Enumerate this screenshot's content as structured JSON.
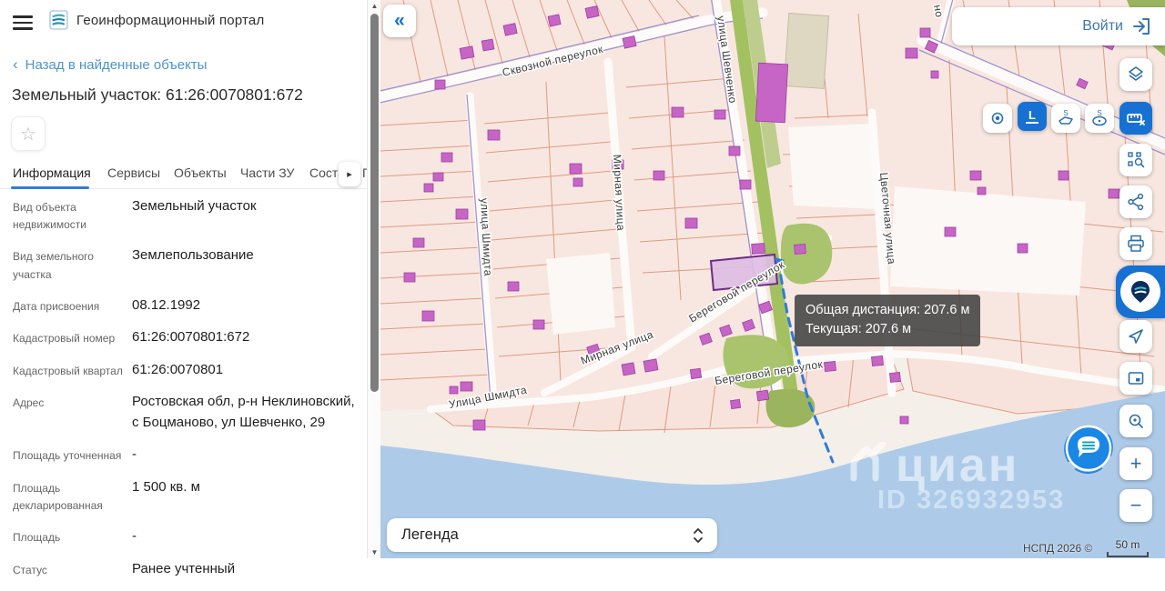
{
  "header": {
    "app_title": "Геоинформационный портал"
  },
  "panel": {
    "back_chevron": "‹",
    "back_link": "Назад в найденные объекты",
    "title": "Земельный участок: 61:26:0070801:672",
    "star": "☆",
    "tabs": [
      {
        "label": "Информация"
      },
      {
        "label": "Сервисы"
      },
      {
        "label": "Объекты"
      },
      {
        "label": "Части ЗУ"
      },
      {
        "label": "Соста"
      },
      {
        "label": "Г"
      }
    ],
    "tabs_arrow": "▸",
    "scroll_up": "▲",
    "scroll_down": "▼",
    "fields": [
      {
        "label": "Вид объекта недвижимости",
        "value": "Земельный участок"
      },
      {
        "label": "Вид земельного участка",
        "value": "Землепользование"
      },
      {
        "label": "Дата присвоения",
        "value": "08.12.1992"
      },
      {
        "label": "Кадастровый номер",
        "value": "61:26:0070801:672"
      },
      {
        "label": "Кадастровый квартал",
        "value": "61:26:0070801"
      },
      {
        "label": "Адрес",
        "value": "Ростовская обл, р-н Неклиновский, с Боцманово, ул Шевченко, 29"
      },
      {
        "label": "Площадь уточненная",
        "value": "-"
      },
      {
        "label": "Площадь декларированная",
        "value": "1 500 кв. м"
      },
      {
        "label": "Площадь",
        "value": "-"
      },
      {
        "label": "Статус",
        "value": "Ранее учтенный"
      }
    ]
  },
  "map": {
    "collapse_glyph": "«",
    "login_label": "Войти",
    "measure_length_glyph": "L",
    "measure_area_glyph": "S",
    "zoom_in": "+",
    "zoom_out": "−",
    "tooltip_line1": "Общая дистанция: 207.6 м",
    "tooltip_line2": "Текущая: 207.6 м",
    "legend_label": "Легенда",
    "attribution": "НСПД 2026 ©",
    "scale_label": "50 m",
    "watermark_brand": "циан",
    "watermark_id": "ID 326932953",
    "streets": {
      "skvoznoy": "Сквозной переулок",
      "shmidta_vertical": "улица Шмидта",
      "mirnaya_vertical": "Мирная улица",
      "shevchenko": "улица Шевченко",
      "cvetochnaya": "Цветочная улица",
      "beregovoy_upper": "Береговой переулок",
      "beregovoy_lower": "Береговой переулок",
      "mirnaya_diagonal": "Мирная улица",
      "shmidta_diagonal": "Улица Шмидта",
      "cut_top": "но"
    }
  }
}
